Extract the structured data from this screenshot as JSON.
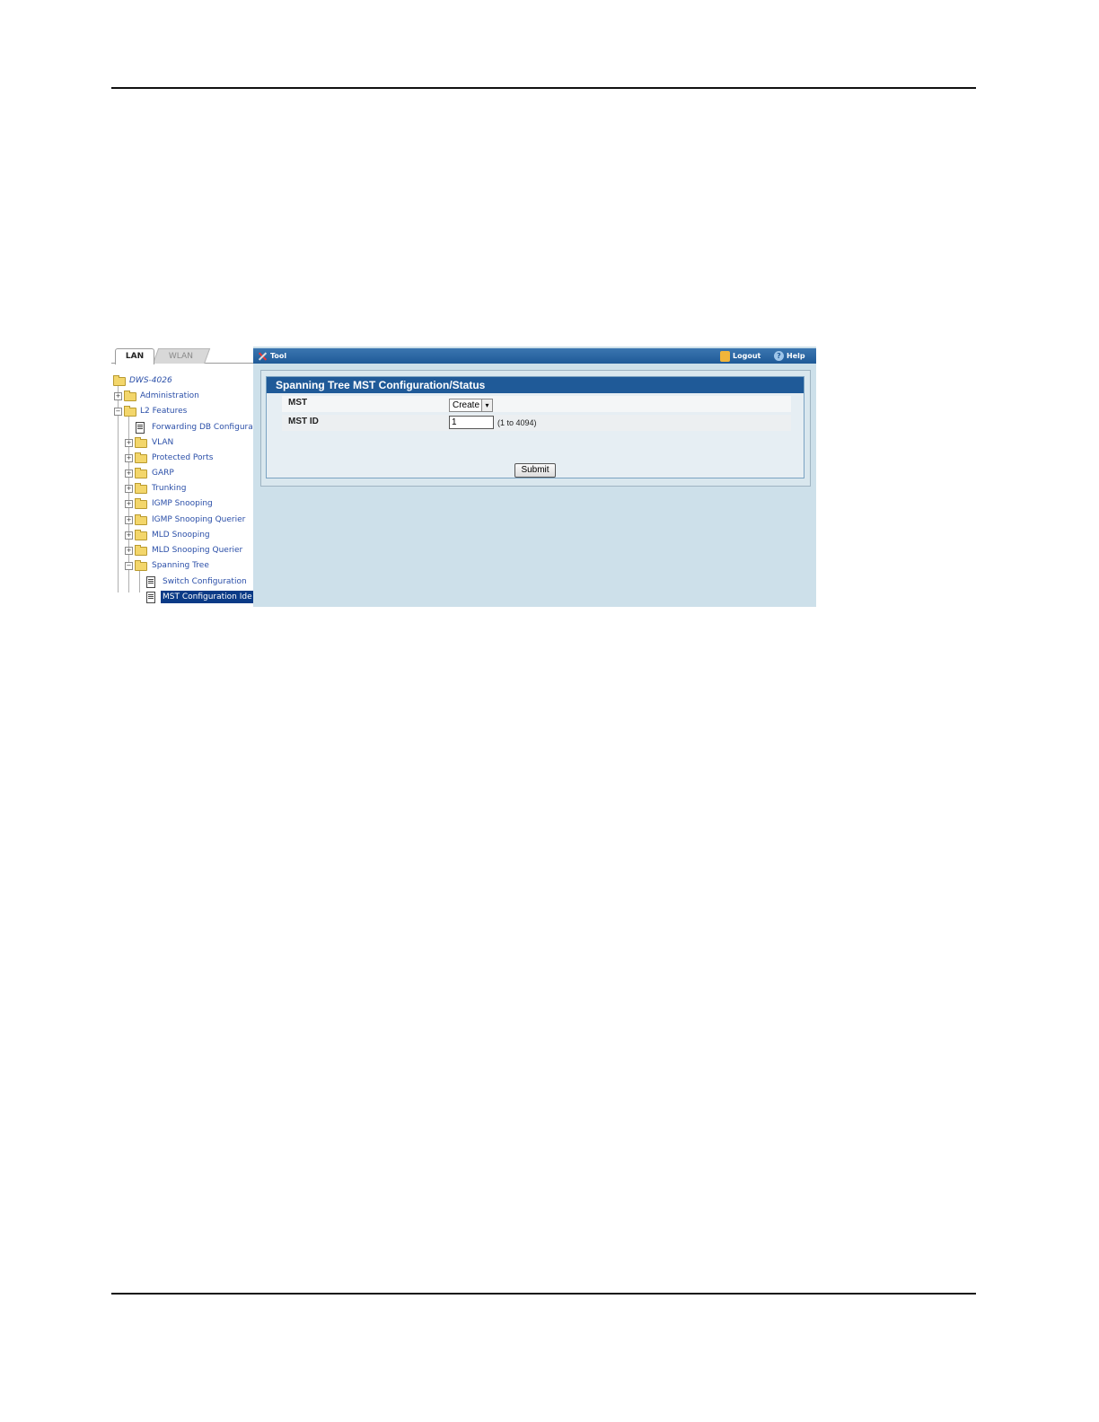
{
  "tabs": {
    "lan": "LAN",
    "wlan": "WLAN"
  },
  "tree": {
    "root": "DWS-4026",
    "items": [
      {
        "label": "Administration",
        "expander": "+"
      },
      {
        "label": "L2 Features",
        "expander": "−"
      },
      {
        "label": "Forwarding DB Configura"
      },
      {
        "label": "VLAN",
        "expander": "+"
      },
      {
        "label": "Protected Ports",
        "expander": "+"
      },
      {
        "label": "GARP",
        "expander": "+"
      },
      {
        "label": "Trunking",
        "expander": "+"
      },
      {
        "label": "IGMP Snooping",
        "expander": "+"
      },
      {
        "label": "IGMP Snooping Querier",
        "expander": "+"
      },
      {
        "label": "MLD Snooping",
        "expander": "+"
      },
      {
        "label": "MLD Snooping Querier",
        "expander": "+"
      },
      {
        "label": "Spanning Tree",
        "expander": "−"
      },
      {
        "label": "Switch Configuration"
      },
      {
        "label": "MST Configuration Ide"
      }
    ]
  },
  "topbar": {
    "tool": "Tool",
    "logout": "Logout",
    "help": "Help",
    "help_glyph": "?"
  },
  "panel": {
    "title": "Spanning Tree MST Configuration/Status",
    "mst_label": "MST",
    "mst_value": "Create",
    "mst_id_label": "MST ID",
    "mst_id_value": "1",
    "mst_id_hint": "(1 to 4094)",
    "submit_label": "Submit",
    "select_arrow": "▾"
  }
}
